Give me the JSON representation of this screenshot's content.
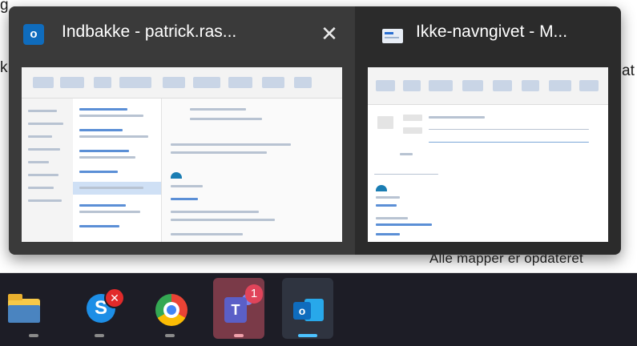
{
  "background": {
    "status_text": "Alle mapper er opdateret",
    "peek_left_top": "g",
    "peek_left_mid": "k",
    "peek_right": "at"
  },
  "flyout": {
    "windows": [
      {
        "title": "Indbakke - patrick.ras...",
        "icon": "outlook-icon",
        "close_label": "✕"
      },
      {
        "title": "Ikke-navngivet - M...",
        "icon": "mail-message-icon"
      }
    ]
  },
  "taskbar": {
    "apps": [
      {
        "name": "File Explorer",
        "icon": "folder-icon"
      },
      {
        "name": "Skype",
        "icon": "skype-icon",
        "badge": "✕"
      },
      {
        "name": "Google Chrome",
        "icon": "chrome-icon"
      },
      {
        "name": "Microsoft Teams",
        "icon": "teams-icon",
        "badge": "1"
      },
      {
        "name": "Outlook",
        "icon": "outlook-icon"
      }
    ]
  },
  "colors": {
    "flyout_bg": "#2b2b2b",
    "taskbar_bg": "#1d1d26",
    "active_indicator": "#4cc2ff",
    "badge_red": "#e22a2a"
  }
}
